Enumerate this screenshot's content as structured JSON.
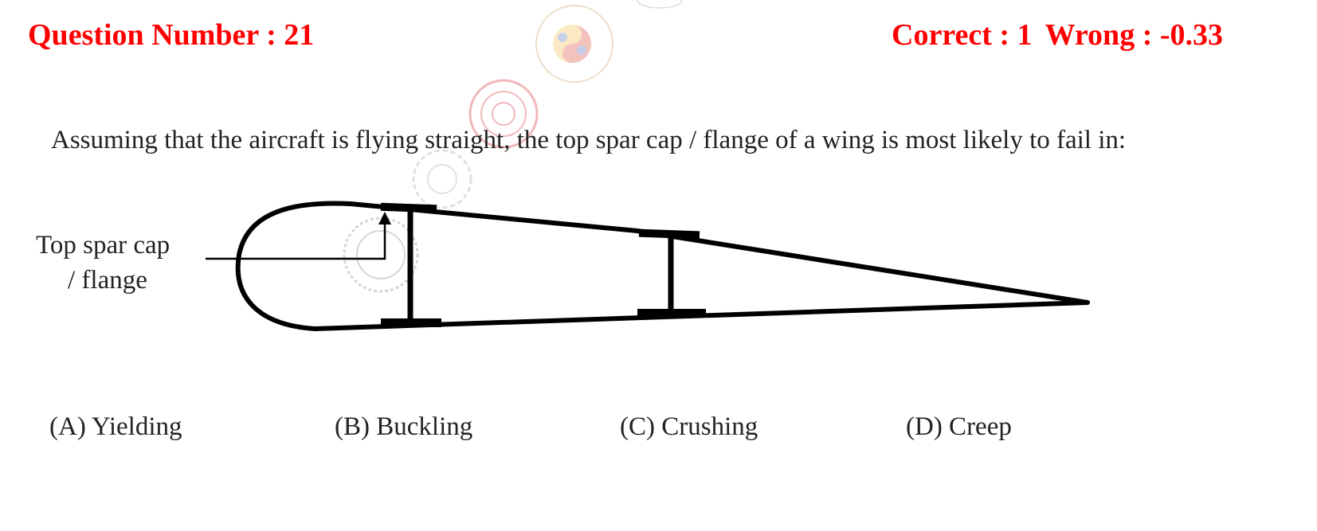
{
  "header": {
    "question_number": "Question Number : 21",
    "correct": "Correct : 1",
    "wrong": "Wrong : -0.33"
  },
  "question": {
    "text": "Assuming that the aircraft is flying straight, the top spar cap / flange of a wing is most likely to fail in:"
  },
  "diagram": {
    "label_line1": "Top spar cap",
    "label_line2": "/ flange"
  },
  "options": [
    {
      "label": "(A) Yielding"
    },
    {
      "label": "(B) Buckling"
    },
    {
      "label": "(C)  Crushing"
    },
    {
      "label": "(D)  Creep"
    }
  ],
  "colors": {
    "header": "#ff0000",
    "text": "#222222"
  }
}
